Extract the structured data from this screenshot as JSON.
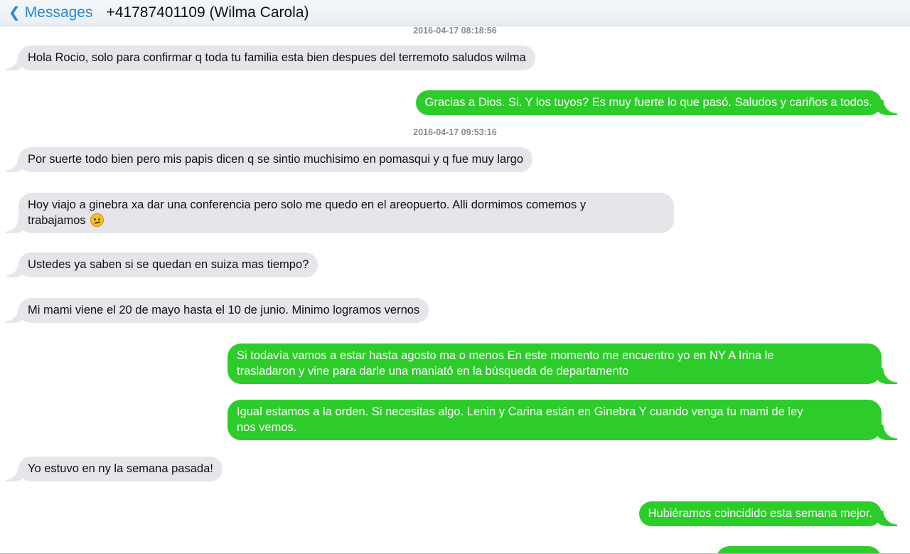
{
  "header": {
    "back_label": "Messages",
    "contact": "+41787401109 (Wilma Carola)"
  },
  "timestamps": [
    "2016-04-17 08:18:56",
    "2016-04-17 09:53:16"
  ],
  "messages": [
    {
      "direction": "in",
      "text": "Hola Rocio, solo para confirmar q toda tu familia esta bien despues del terremoto saludos wilma"
    },
    {
      "direction": "out",
      "text": "Gracias a Dios. Si. Y los tuyos? Es muy fuerte lo que pasó. Saludos y cariños a todos."
    },
    {
      "direction": "in",
      "text": "Por suerte todo bien pero mis papis dicen q se sintio muchisimo en pomasqui y q fue muy largo"
    },
    {
      "direction": "in",
      "text": "Hoy viajo a ginebra xa dar una conferencia pero solo me quedo en el areopuerto. Alli dormimos comemos y",
      "text2": "trabajamos",
      "emoji": "confused-face"
    },
    {
      "direction": "in",
      "text": "Ustedes ya saben si se quedan en suiza mas tiempo?"
    },
    {
      "direction": "in",
      "text": "Mi mami viene el 20 de mayo hasta el 10 de junio. Minimo logramos vernos"
    },
    {
      "direction": "out",
      "text": "Si todavía vamos a estar hasta agosto ma o menos En este momento me encuentro yo en NY A Irina le",
      "text2": "trasladaron y vine para darle una maniató en la búsqueda de departamento"
    },
    {
      "direction": "out",
      "text": "Igual estamos a la orden. Si necesitas algo. Lenin y Carina están en Ginebra Y cuando venga tu mami de ley",
      "text2": "nos vemos."
    },
    {
      "direction": "in",
      "text": "Yo estuvo en ny la semana pasada!"
    },
    {
      "direction": "out",
      "text": "Hubiéramos coincidido esta semana mejor."
    }
  ],
  "colors": {
    "incoming_bubble": "#e5e5ea",
    "outgoing_bubble": "#2dcc2a",
    "link_blue": "#2a86d4"
  }
}
